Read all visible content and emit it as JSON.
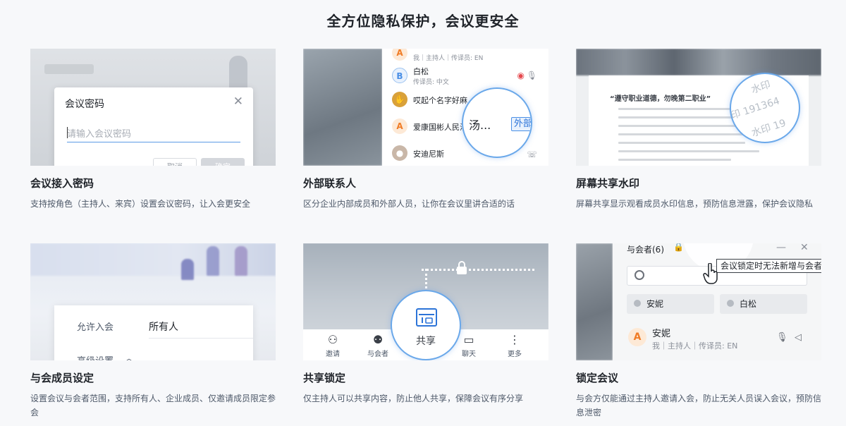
{
  "page": {
    "title": "全方位隐私保护，会议更安全"
  },
  "cards": [
    {
      "title": "会议接入密码",
      "desc": "支持按角色（主持人、来宾）设置会议密码，让入会更安全",
      "mock": {
        "dialog_title": "会议密码",
        "placeholder": "请输入会议密码",
        "cancel": "取消",
        "confirm": "确定"
      }
    },
    {
      "title": "外部联系人",
      "desc": "区分企业内部成员和外部人员，让你在会议里讲合适的话",
      "mock": {
        "rows": [
          {
            "name": "",
            "sub": "我｜主持人｜传译员: EN"
          },
          {
            "name": "白松",
            "sub": "传译员: 中文"
          },
          {
            "name": "哎起个名字好麻",
            "sub": ""
          },
          {
            "name": "爱康国彬人民汤",
            "sub": ""
          },
          {
            "name": "安迪尼斯",
            "sub": ""
          }
        ],
        "magnifier_text": "汤...",
        "external_tag": "外部"
      }
    },
    {
      "title": "屏幕共享水印",
      "desc": "屏幕共享显示观看成员水印信息，预防信息泄露，保护会议隐私",
      "mock": {
        "doc_heading": "“遵守职业道德，勿晚第二职业”",
        "watermark_1": "水印",
        "watermark_2": "印 191364",
        "watermark_3": "水印 19"
      }
    },
    {
      "title": "与会成员设定",
      "desc": "设置会议与会者范围，支持所有人、企业成员、仅邀请成员限定参会",
      "mock": {
        "allow_label": "允许入会",
        "allow_value": "所有人",
        "advanced_label": "高级设置"
      }
    },
    {
      "title": "共享锁定",
      "desc": "仅主持人可以共享内容，防止他人共享，保障会议有序分享",
      "mock": {
        "toolbar": [
          "邀请",
          "与会者",
          "共享",
          "聊天",
          "更多"
        ],
        "share_label": "共享"
      }
    },
    {
      "title": "锁定会议",
      "desc": "与会方仅能通过主持人邀请入会，防止无关人员误入会议，预防信息泄密",
      "mock": {
        "panel_title": "与会者(6)",
        "tooltip": "会议锁定时无法新增与会者",
        "chips": [
          "安妮",
          "白松"
        ],
        "member_name": "安妮",
        "member_sub": "我｜主持人｜传译员: EN"
      }
    }
  ]
}
